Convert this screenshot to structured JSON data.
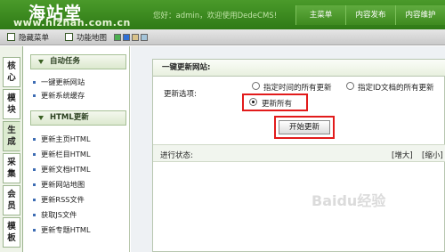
{
  "header": {
    "brand_cn": "海站堂",
    "brand_url": "www.hizhan.com.cn",
    "welcome": "您好：admin，欢迎使用DedeCMS!",
    "nav": [
      "主菜单",
      "内容发布",
      "内容维护"
    ]
  },
  "subbar": {
    "hide_menu": "隐藏菜单",
    "site_map": "功能地图",
    "swatch_colors": [
      "#4caf50",
      "#2f6fd6",
      "#d9c28a",
      "#a4c4d9"
    ]
  },
  "tabs": [
    "核心",
    "模块",
    "生成",
    "采集",
    "会员",
    "模板"
  ],
  "menu": {
    "groups": [
      {
        "title": "自动任务",
        "items": [
          "一键更新网站",
          "更新系统缓存"
        ]
      },
      {
        "title": "HTML更新",
        "items": [
          "更新主页HTML",
          "更新栏目HTML",
          "更新文档HTML",
          "更新网站地图",
          "更新RSS文件",
          "获取JS文件",
          "更新专题HTML"
        ]
      }
    ]
  },
  "panel": {
    "title": "一键更新网站:",
    "option_label": "更新选项:",
    "option_time": "指定时间的所有更新",
    "option_id": "指定ID文档的所有更新",
    "option_all": "更新所有",
    "start_button": "开始更新",
    "status_label": "进行状态:",
    "enlarge": "[增大]",
    "shrink": "[缩小]"
  },
  "watermark": "Baidu经验"
}
